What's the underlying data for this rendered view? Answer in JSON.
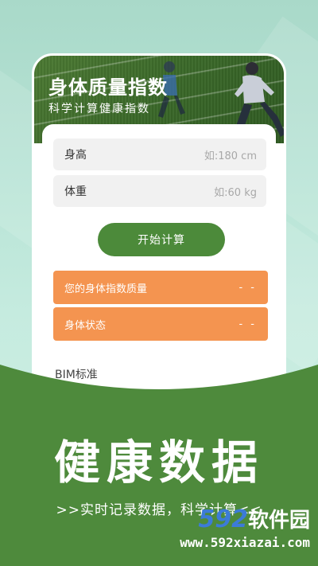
{
  "app": {
    "title": "身体质量指数",
    "subtitle": "科学计算健康指数"
  },
  "form": {
    "height": {
      "label": "身高",
      "placeholder": "如:180 cm"
    },
    "weight": {
      "label": "体重",
      "placeholder": "如:60  kg"
    },
    "submit_label": "开始计算"
  },
  "results": [
    {
      "label": "您的身体指数质量",
      "value": "- -"
    },
    {
      "label": "身体状态",
      "value": "- -"
    }
  ],
  "bim_section_title": "BIM标准",
  "promo": {
    "headline": "健康数据",
    "tagline": ">>实时记录数据，科学计算<<"
  },
  "watermark": {
    "number": "592",
    "text": "软件园",
    "url": "www.592xiazai.com"
  },
  "colors": {
    "primary_green": "#4c8a3a",
    "result_orange": "#f49450",
    "wave_green": "#4e8a3c",
    "background_mint": "#b7e3d5"
  },
  "icons": [
    "runner-figure-icon"
  ]
}
